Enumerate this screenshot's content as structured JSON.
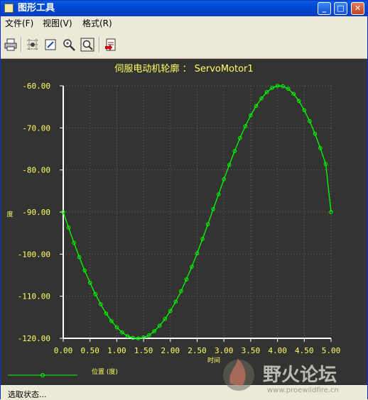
{
  "window": {
    "title": "图形工具"
  },
  "menu": [
    "文件(F)",
    "视图(V)",
    "格式(R)"
  ],
  "toolbar": [
    "print-icon",
    "grid-icon",
    "edit-icon",
    "zoom-in-icon",
    "zoom-fit-icon",
    "export-icon"
  ],
  "chart_data": {
    "type": "line",
    "title": "伺服电动机轮廓 ： ServoMotor1",
    "xlabel": "位置 (度)",
    "xlabel_extra": "时间",
    "ylabel": "度",
    "xlim": [
      0,
      5
    ],
    "ylim": [
      -120,
      -60
    ],
    "xticks": [
      "0.00",
      "0.50",
      "1.00",
      "1.50",
      "2.00",
      "2.50",
      "3.00",
      "3.50",
      "4.00",
      "4.50",
      "5.00"
    ],
    "yticks": [
      "-60.00",
      "-70.00",
      "-80.00",
      "-90.00",
      "-100.00",
      "-110.00",
      "-120.00"
    ],
    "series": [
      {
        "name": "",
        "color": "#00FF00",
        "x": [
          0,
          0.1,
          0.2,
          0.3,
          0.4,
          0.5,
          0.6,
          0.7,
          0.8,
          0.9,
          1.0,
          1.1,
          1.2,
          1.3,
          1.4,
          1.5,
          1.6,
          1.7,
          1.8,
          1.9,
          2.0,
          2.1,
          2.2,
          2.3,
          2.4,
          2.5,
          2.6,
          2.7,
          2.8,
          2.9,
          3.0,
          3.1,
          3.2,
          3.3,
          3.4,
          3.5,
          3.6,
          3.7,
          3.8,
          3.9,
          4.0,
          4.1,
          4.2,
          4.3,
          4.4,
          4.5,
          4.6,
          4.7,
          4.8,
          4.9,
          5.0
        ],
        "y": [
          -90,
          -93.7,
          -97.3,
          -100.7,
          -103.9,
          -106.8,
          -109.5,
          -111.9,
          -114.1,
          -115.9,
          -117.4,
          -118.6,
          -119.5,
          -119.9,
          -120,
          -119.8,
          -119.3,
          -118.3,
          -117.0,
          -115.4,
          -113.5,
          -111.3,
          -108.8,
          -106.0,
          -103.0,
          -99.8,
          -96.4,
          -92.9,
          -89.3,
          -85.8,
          -82.2,
          -78.8,
          -75.5,
          -72.4,
          -69.6,
          -67.0,
          -64.8,
          -63.0,
          -61.5,
          -60.5,
          -60.0,
          -60.1,
          -60.7,
          -61.9,
          -63.6,
          -65.8,
          -68.4,
          -71.4,
          -74.8,
          -78.6,
          -90.0
        ]
      }
    ]
  },
  "status": {
    "text": "选取状态..."
  },
  "watermark": {
    "text": "野火论坛",
    "url": "www.proewildfire.cn"
  }
}
